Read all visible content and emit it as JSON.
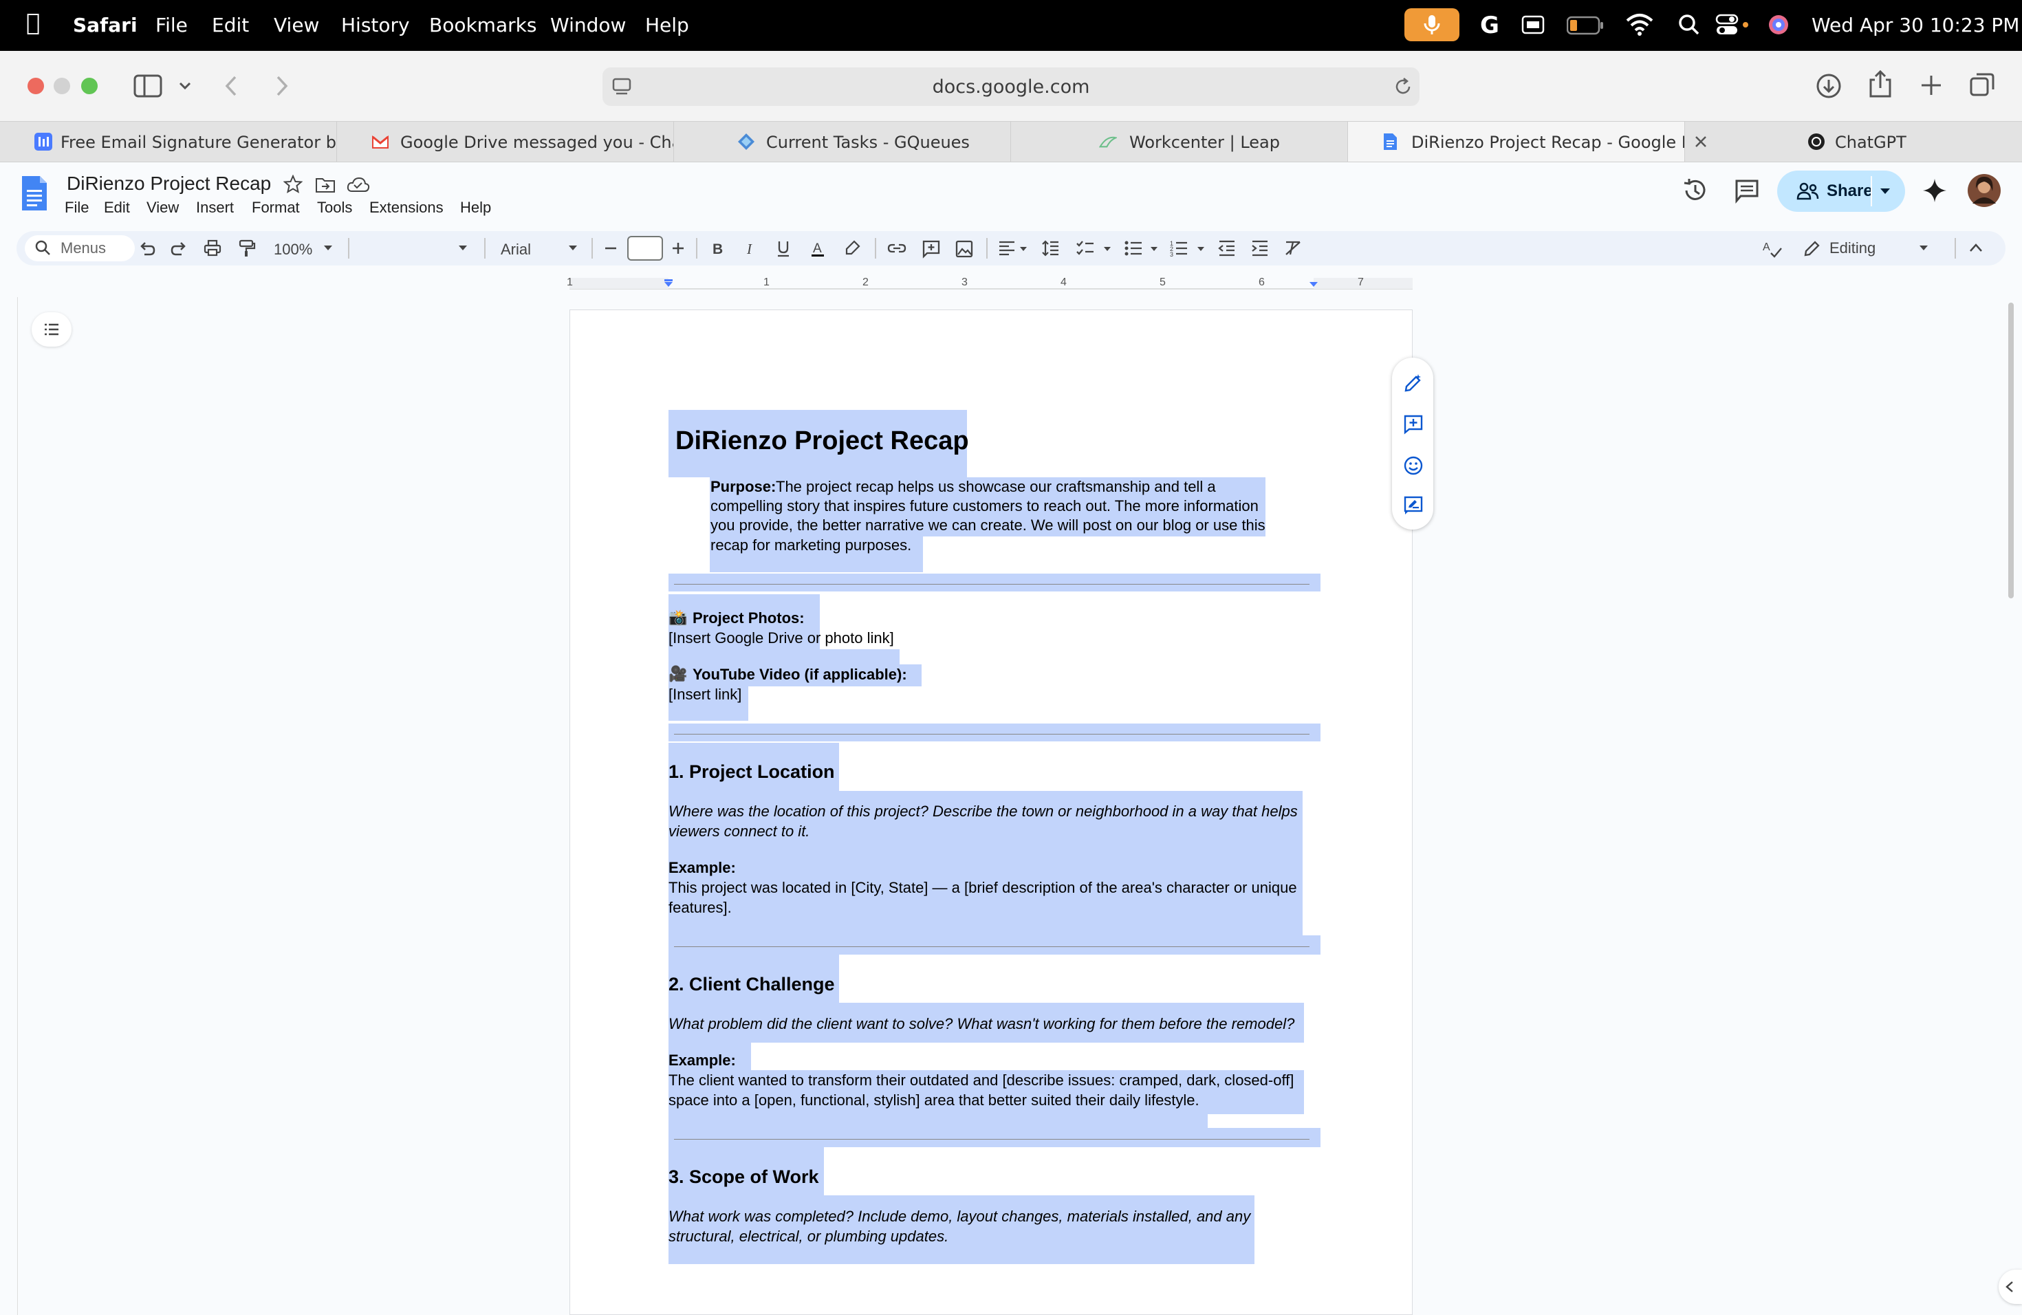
{
  "menubar": {
    "app": "Safari",
    "items": [
      "File",
      "Edit",
      "View",
      "History",
      "Bookmarks",
      "Window",
      "Help"
    ],
    "clock": "Wed Apr 30  10:23 PM"
  },
  "browser": {
    "url": "docs.google.com",
    "tabs": [
      {
        "label": "Free Email Signature Generator by...",
        "icon": "hubspot-icon"
      },
      {
        "label": "Google Drive messaged you - Chat",
        "icon": "gmail-icon"
      },
      {
        "label": "Current Tasks - GQueues",
        "icon": "gqueues-icon"
      },
      {
        "label": "Workcenter | Leap",
        "icon": "leap-icon"
      },
      {
        "label": "DiRienzo Project Recap - Google D...",
        "icon": "google-docs-icon"
      },
      {
        "label": "ChatGPT",
        "icon": "chatgpt-icon"
      }
    ]
  },
  "docs": {
    "title": "DiRienzo Project Recap",
    "menu": [
      "File",
      "Edit",
      "View",
      "Insert",
      "Format",
      "Tools",
      "Extensions",
      "Help"
    ],
    "share_label": "Share",
    "toolbar": {
      "search": "Menus",
      "zoom": "100%",
      "font": "Arial",
      "mode": "Editing"
    },
    "ruler_numbers": [
      "1",
      "1",
      "2",
      "3",
      "4",
      "5",
      "6",
      "7"
    ]
  },
  "document": {
    "heading": "DiRienzo Project Recap",
    "purpose_label": "Purpose:",
    "purpose_lines": [
      " The project recap helps us showcase our craftsmanship and tell a",
      "compelling story that inspires future customers to reach out. The more information",
      "you provide, the better narrative we can create. We will post on our blog or use this",
      "recap for marketing purposes."
    ],
    "photos_emoji": "📸",
    "photos_label": "Project Photos:",
    "photos_value": "[Insert Google Drive or photo link]",
    "video_emoji": "🎥",
    "video_label": "YouTube Video (if applicable):",
    "video_value": "[Insert link]",
    "sections": [
      {
        "title": "1. Project Location",
        "prompt": [
          "Where was the location of this project? Describe the town or neighborhood in a way that helps",
          "viewers connect to it."
        ],
        "example_label": "Example:",
        "example": [
          "This project was located in [City, State] — a [brief description of the area's character or unique",
          "features]."
        ]
      },
      {
        "title": "2. Client Challenge",
        "prompt": [
          "What problem did the client want to solve? What wasn't working for them before the remodel?"
        ],
        "example_label": "Example:",
        "example": [
          "The client wanted to transform their outdated and [describe issues: cramped, dark, closed-off]",
          "space into a [open, functional, stylish] area that better suited their daily lifestyle."
        ]
      },
      {
        "title": "3. Scope of Work",
        "prompt": [
          "What work was completed? Include demo, layout changes, materials installed, and any",
          "structural, electrical, or plumbing updates."
        ]
      }
    ]
  },
  "colors": {
    "selection": "#c2d4fb",
    "share_bg": "#c2e7ff",
    "docs_blue": "#4285f4"
  }
}
